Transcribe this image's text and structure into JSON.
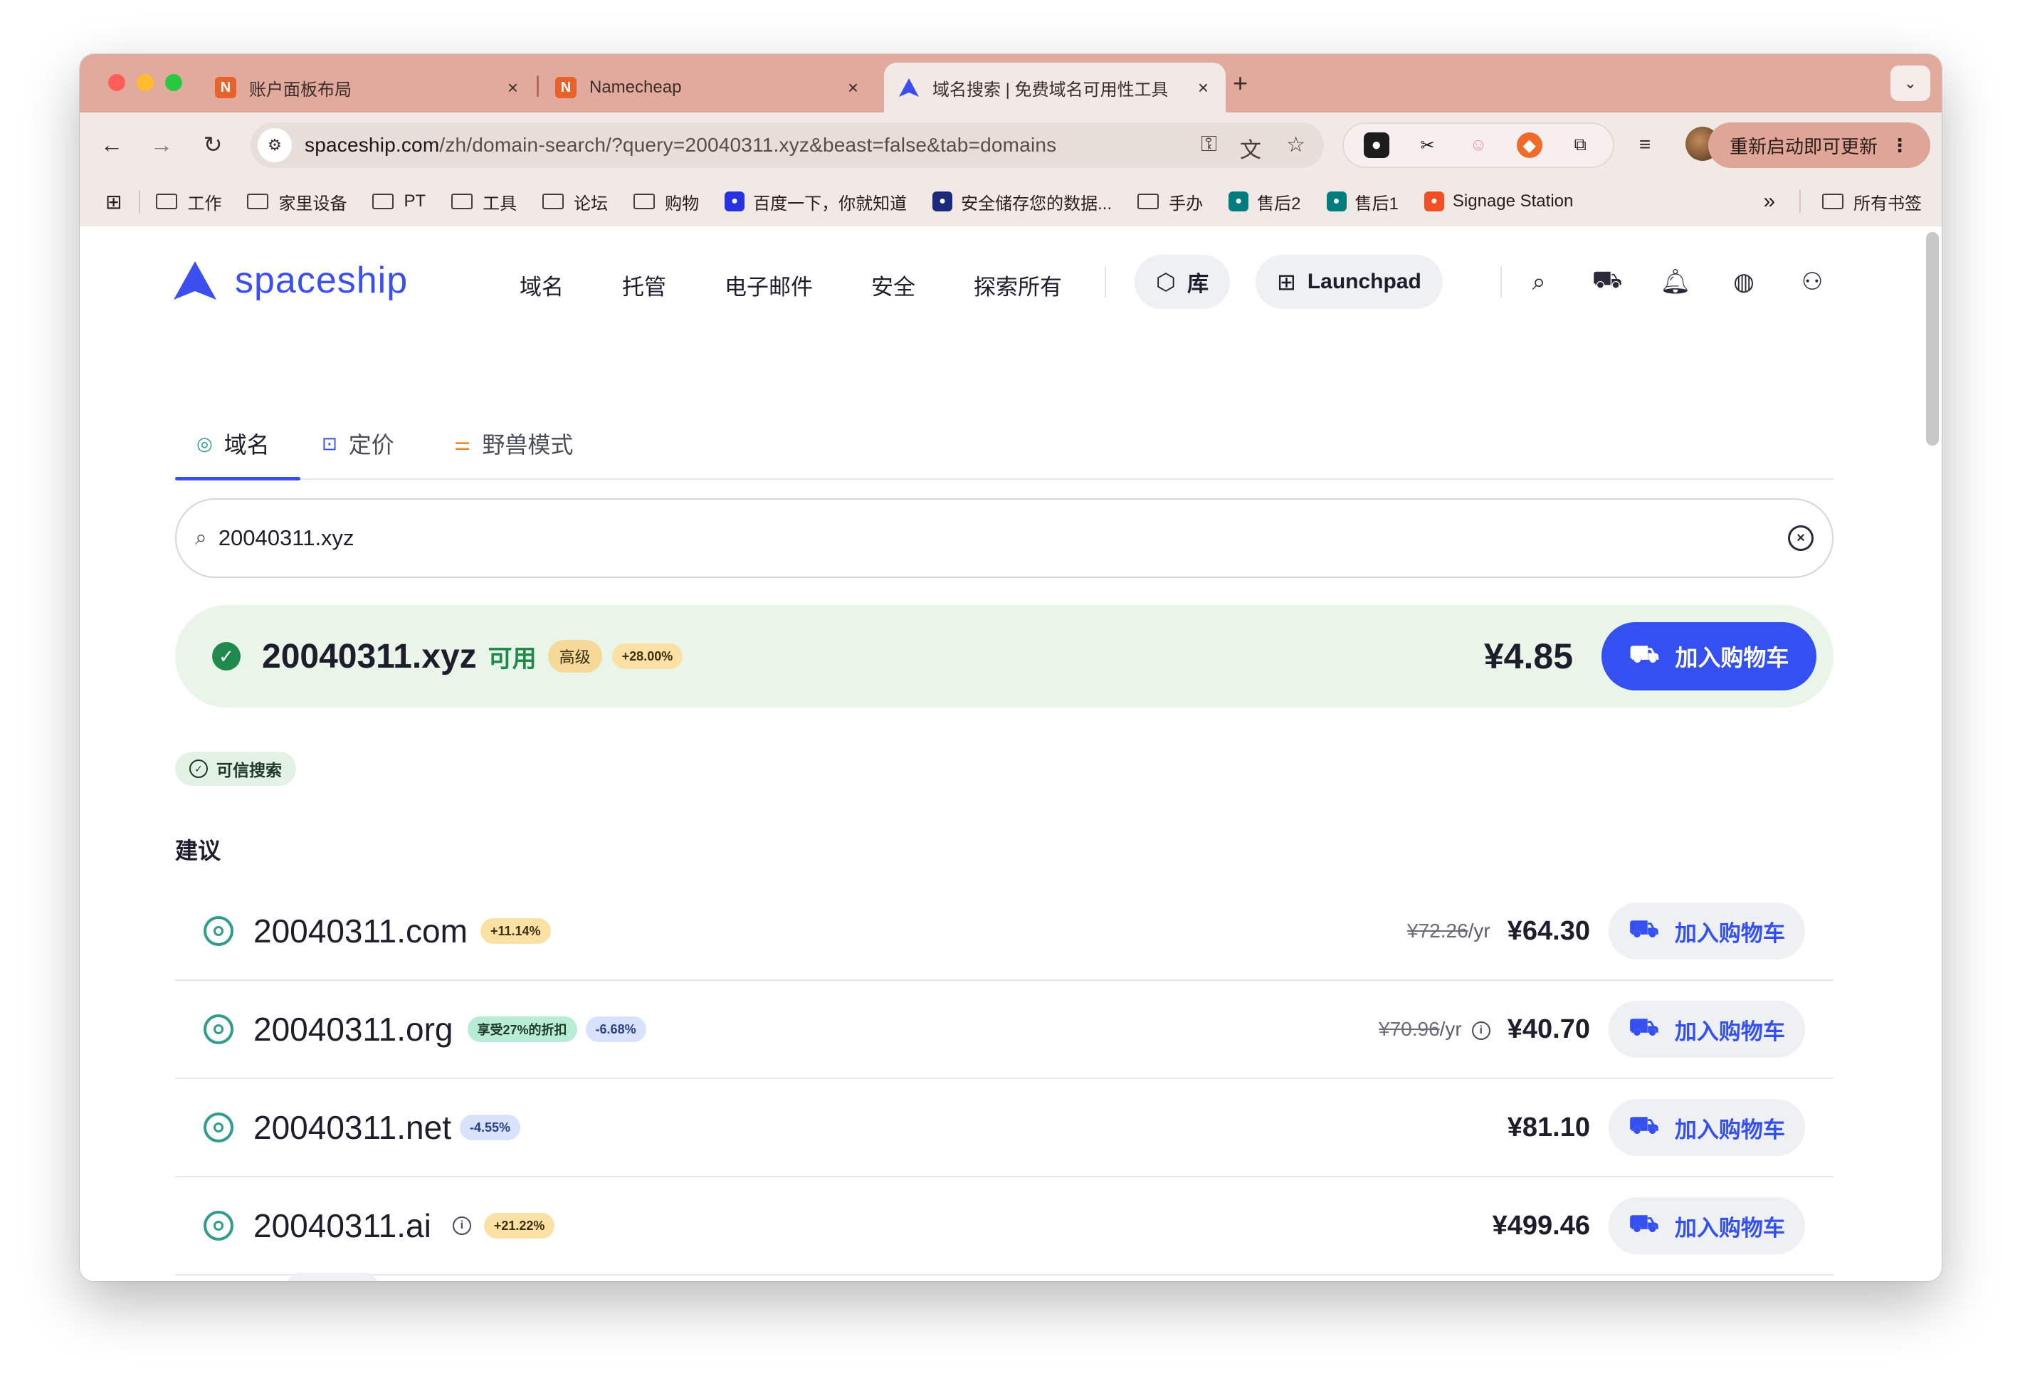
{
  "browser": {
    "tabs": [
      {
        "title": "账户面板布局",
        "close": "×"
      },
      {
        "title": "Namecheap",
        "close": "×"
      },
      {
        "title": "域名搜索 | 免费域名可用性工具",
        "close": "×"
      }
    ],
    "new_tab": "+",
    "tab_menu": "⌄",
    "url_host": "spaceship.com",
    "url_path": "/zh/domain-search/?query=20040311.xyz&beast=false&tab=domains",
    "update_button": "重新启动即可更新",
    "update_menu": "⋮",
    "bookmarks": [
      {
        "label": "工作",
        "type": "folder"
      },
      {
        "label": "家里设备",
        "type": "folder"
      },
      {
        "label": "PT",
        "type": "folder"
      },
      {
        "label": "工具",
        "type": "folder"
      },
      {
        "label": "论坛",
        "type": "folder"
      },
      {
        "label": "购物",
        "type": "folder"
      },
      {
        "label": "百度一下，你就知道",
        "type": "link",
        "icon": "baidu-icon",
        "color": "#2932e1"
      },
      {
        "label": "安全储存您的数据...",
        "type": "link",
        "icon": "storage-icon",
        "color": "#1b2a7a"
      },
      {
        "label": "手办",
        "type": "folder"
      },
      {
        "label": "售后2",
        "type": "link",
        "icon": "sharepoint-icon",
        "color": "#037c7e"
      },
      {
        "label": "售后1",
        "type": "link",
        "icon": "sharepoint-icon",
        "color": "#037c7e"
      },
      {
        "label": "Signage Station",
        "type": "link",
        "icon": "signage-icon",
        "color": "#f25022"
      }
    ],
    "bookmarks_overflow": "»",
    "all_bookmarks": "所有书签"
  },
  "site": {
    "logo_text": "spaceship",
    "brand_color": "#3b4ef0",
    "nav": [
      "域名",
      "托管",
      "电子邮件",
      "安全",
      "探索所有"
    ],
    "library_label": "库",
    "launchpad_label": "Launchpad",
    "header_icons": [
      "search-icon",
      "cart-icon",
      "bell-icon",
      "globe-icon",
      "user-icon"
    ]
  },
  "subtabs": [
    {
      "label": "域名",
      "icon": "domain-icon",
      "active": true
    },
    {
      "label": "定价",
      "icon": "price-icon",
      "active": false
    },
    {
      "label": "野兽模式",
      "icon": "sliders-icon",
      "active": false
    }
  ],
  "search": {
    "value": "20040311.xyz"
  },
  "featured": {
    "domain": "20040311.xyz",
    "status": "可用",
    "tier_badge": "高级",
    "change_badge": "+28.00%",
    "price": "¥4.85",
    "cart_label": "加入购物车"
  },
  "trusted_label": "可信搜索",
  "suggestions_title": "建议",
  "suggestions": [
    {
      "domain": "20040311.com",
      "badges": [
        {
          "text": "+11.14%",
          "kind": "gold"
        }
      ],
      "old_price": "¥72.26",
      "per": "/yr",
      "price": "¥64.30",
      "cart_label": "加入购物车"
    },
    {
      "domain": "20040311.org",
      "badges": [
        {
          "text": "享受27%的折扣",
          "kind": "green"
        },
        {
          "text": "-6.68%",
          "kind": "blue"
        }
      ],
      "old_price": "¥70.96",
      "per": "/yr",
      "price": "¥40.70",
      "cart_label": "加入购物车"
    },
    {
      "domain": "20040311.net",
      "badges": [
        {
          "text": "-4.55%",
          "kind": "blue"
        }
      ],
      "old_price": "",
      "per": "",
      "price": "¥81.10",
      "cart_label": "加入购物车"
    },
    {
      "domain": "20040311.ai",
      "badges": [
        {
          "text": "+21.22%",
          "kind": "gold"
        }
      ],
      "old_price": "",
      "per": "",
      "price": "¥499.46",
      "cart_label": "加入购物车"
    }
  ]
}
